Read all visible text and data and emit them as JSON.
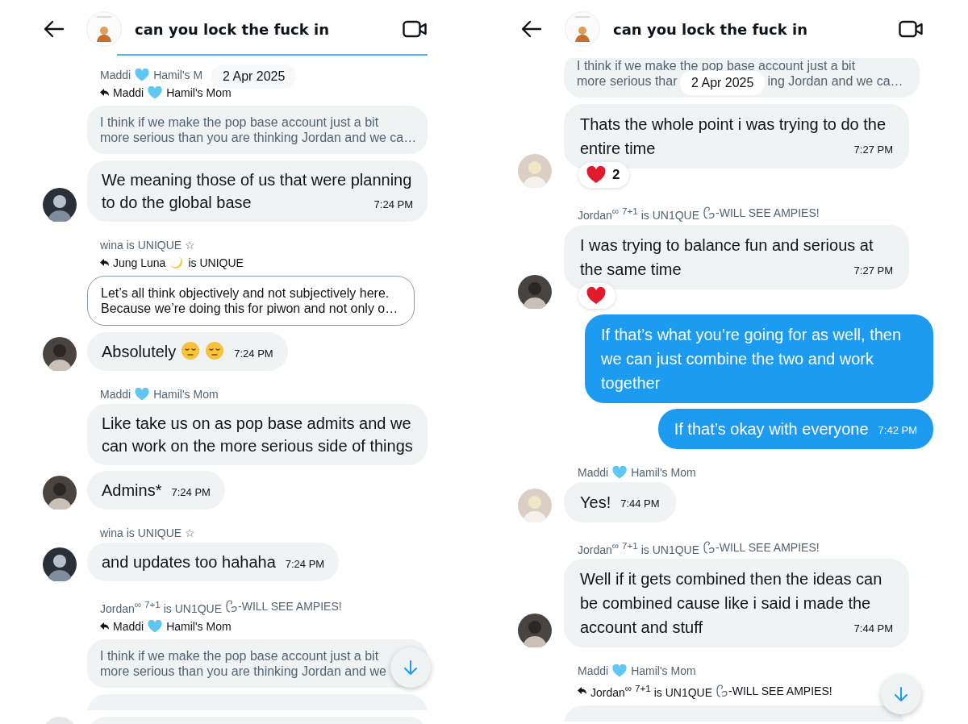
{
  "panes": [
    {
      "header": {
        "title": "can you lock the fuck in"
      },
      "date": "2 Apr 2025",
      "items": [
        {
          "kind": "edge"
        },
        {
          "kind": "sender",
          "name": [
            {
              "text": "Maddi"
            },
            {
              "kind": "heart"
            },
            {
              "text": "Hamil's M"
            }
          ]
        },
        {
          "kind": "reply",
          "name": [
            {
              "text": "Maddi"
            },
            {
              "kind": "heart"
            },
            {
              "text": "Hamil's Mom"
            }
          ]
        },
        {
          "kind": "quote",
          "outlined": false,
          "lines": [
            [
              "I think if we make the pop base account just a bit"
            ],
            [
              "more serious than you are thinking Jordan and we ca…"
            ]
          ]
        },
        {
          "kind": "incoming",
          "avatar": true,
          "text": "We meaning those of us that were planning to do the global base",
          "time": "7:24 PM"
        },
        {
          "kind": "sender",
          "name": [
            {
              "text": "wina is UNIQUE ☆"
            }
          ]
        },
        {
          "kind": "reply",
          "name": [
            {
              "text": "Jung Luna"
            },
            {
              "kind": "moon"
            },
            {
              "text": "is UNIQUE"
            }
          ]
        },
        {
          "kind": "quote",
          "outlined": true,
          "lines": [
            [
              "Let’s all think objectively and not subjectively here."
            ],
            [
              "Because we’re doing this for piwon and not only o…"
            ]
          ]
        },
        {
          "kind": "incoming",
          "avatar": true,
          "text": "Absolutely",
          "emojis": [
            {
              "kind": "pensive"
            },
            {
              "kind": "pensive"
            }
          ],
          "time": "7:24 PM"
        },
        {
          "kind": "sender",
          "name": [
            {
              "text": "Maddi"
            },
            {
              "kind": "heart"
            },
            {
              "text": "Hamil's Mom"
            }
          ]
        },
        {
          "kind": "incoming",
          "avatar": false,
          "text": "Like take us on as pop base admits and we can work on the more serious side of things"
        },
        {
          "kind": "incoming",
          "avatar": true,
          "text": "Admins*",
          "time": "7:24 PM"
        },
        {
          "kind": "sender",
          "name": [
            {
              "text": "wina is UNIQUE ☆"
            }
          ]
        },
        {
          "kind": "incoming",
          "avatar": true,
          "text": "and updates too hahaha",
          "time": "7:24 PM"
        },
        {
          "kind": "sender",
          "name": [
            {
              "text": "Jordan$^{∞}$ $^{7+1}$ is UN1QUE"
            },
            {
              "kind": "swirl"
            },
            {
              "text": "-WILL SEE AMPIES!"
            }
          ]
        },
        {
          "kind": "reply",
          "name": [
            {
              "text": "Maddi"
            },
            {
              "kind": "heart"
            },
            {
              "text": "Hamil's Mom"
            }
          ]
        },
        {
          "kind": "quote",
          "outlined": false,
          "lines": [
            [
              "I think if we make the pop base account just a bit"
            ],
            [
              "more serious than you are thinking Jordan and we"
            ]
          ]
        },
        {
          "kind": "clipped",
          "avatar": false
        },
        {
          "kind": "clipped",
          "avatar": true
        }
      ]
    },
    {
      "header": {
        "title": "can you lock the fuck in"
      },
      "date": "2 Apr 2025",
      "items": [
        {
          "kind": "quote",
          "outlined": false,
          "lines": [
            [
              "I think if we make the pop base account just a bit"
            ],
            [
              "more serious thar",
              "ing Jordan and we ca…"
            ]
          ]
        },
        {
          "kind": "incoming",
          "avatar": true,
          "text": "Thats the whole point i was trying to do the entire time",
          "time": "7:27 PM",
          "reactions": [
            {
              "kind": "heart",
              "count": "2"
            }
          ]
        },
        {
          "kind": "sender",
          "name": [
            {
              "text": "Jordan$^{∞}$ $^{7+1}$ is UN1QUE"
            },
            {
              "kind": "swirl"
            },
            {
              "text": "-WILL SEE AMPIES!"
            }
          ]
        },
        {
          "kind": "incoming",
          "avatar": true,
          "text": "I was trying to balance fun and serious at the same time",
          "time": "7:27 PM",
          "reactions": [
            {
              "kind": "heart"
            }
          ]
        },
        {
          "kind": "outgoing",
          "text": "If that’s what you’re going for as well, then we can just combine the two and work together"
        },
        {
          "kind": "outgoing",
          "text": "If that’s okay with everyone",
          "time": "7:42 PM"
        },
        {
          "kind": "sender",
          "name": [
            {
              "text": "Maddi"
            },
            {
              "kind": "heart"
            },
            {
              "text": "Hamil's Mom"
            }
          ]
        },
        {
          "kind": "incoming",
          "avatar": true,
          "text": "Yes!",
          "time": "7:44 PM"
        },
        {
          "kind": "sender",
          "name": [
            {
              "text": "Jordan$^{∞}$ $^{7+1}$ is UN1QUE"
            },
            {
              "kind": "swirl"
            },
            {
              "text": "-WILL SEE AMPIES!"
            }
          ]
        },
        {
          "kind": "incoming",
          "avatar": true,
          "text": "Well if it gets combined then the ideas can be combined cause like i said i made the account and stuff",
          "time": "7:44 PM"
        },
        {
          "kind": "sender",
          "name": [
            {
              "text": "Maddi"
            },
            {
              "kind": "heart"
            },
            {
              "text": "Hamil's Mom"
            }
          ]
        },
        {
          "kind": "reply",
          "name": [
            {
              "text": "Jordan$^{∞}$ $^{7+1}$ is UN1QUE"
            },
            {
              "kind": "swirl"
            },
            {
              "text": "-WILL SEE AMPIES!"
            }
          ]
        },
        {
          "kind": "clipped",
          "avatar": false
        }
      ]
    }
  ]
}
